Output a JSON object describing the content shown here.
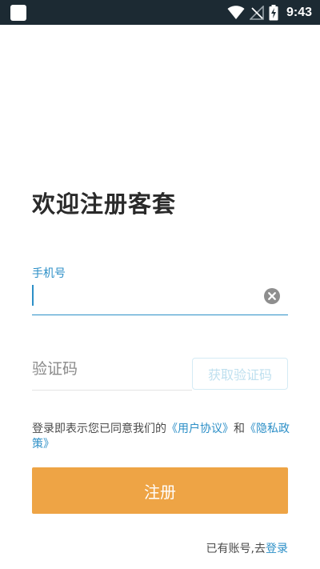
{
  "status_bar": {
    "time": "9:43",
    "icons": [
      "app-icon",
      "wifi-icon",
      "no-signal-icon",
      "battery-charging-icon"
    ],
    "background": "#1c2a33"
  },
  "title": "欢迎注册客套",
  "phone": {
    "label": "手机号",
    "value": "",
    "placeholder": "",
    "clear_icon": "clear-circle-icon"
  },
  "verify_code": {
    "placeholder": "验证码",
    "value": "",
    "get_code_label": "获取验证码"
  },
  "agreement": {
    "prefix": "登录即表示您已同意我们的",
    "user_agreement": "《用户协议》",
    "conjunction": "和",
    "privacy_policy": "《隐私政策》"
  },
  "register_label": "注册",
  "login": {
    "prompt": "已有账号,去",
    "link": "登录"
  },
  "colors": {
    "accent": "#2c8fc7",
    "primary_button": "#eea445",
    "text": "#2a2a2a"
  }
}
